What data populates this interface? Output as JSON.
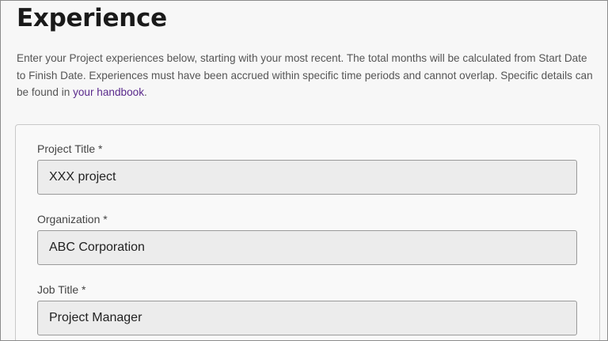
{
  "page": {
    "title": "Experience",
    "intro_text": "Enter your Project experiences below, starting with your most recent. The total months will be calculated from Start Date to Finish Date. Experiences must have been accrued within specific time periods and cannot overlap. Specific details can be found in ",
    "handbook_link": "your handbook",
    "intro_suffix": "."
  },
  "form": {
    "project_title": {
      "label": "Project Title *",
      "value": "XXX project"
    },
    "organization": {
      "label": "Organization *",
      "value": "ABC Corporation"
    },
    "job_title": {
      "label": "Job Title *",
      "value": "Project Manager"
    }
  },
  "colors": {
    "link": "#5a2a8c",
    "input_background": "#ececec",
    "heading": "#1a1a1a"
  }
}
